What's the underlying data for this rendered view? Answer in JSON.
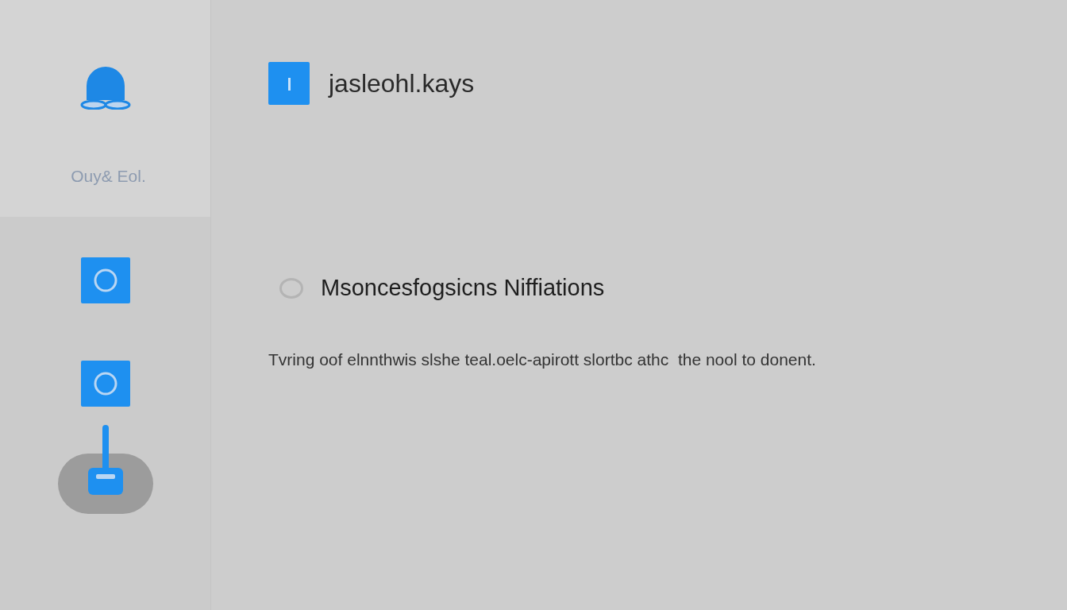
{
  "sidebar": {
    "profile": {
      "label": "Ouy& Eol."
    },
    "items": [
      {
        "kind": "square",
        "selected": false
      },
      {
        "kind": "square",
        "selected": false
      },
      {
        "kind": "lever",
        "selected": true
      }
    ]
  },
  "header": {
    "title": "jasleohl.kays"
  },
  "option": {
    "label": "Msoncesfogsicns Niffiations",
    "checked": false
  },
  "description": "Tvring oof elnnthwis slshe teal.oelc-apirott slortbc athc  the nool to donent."
}
